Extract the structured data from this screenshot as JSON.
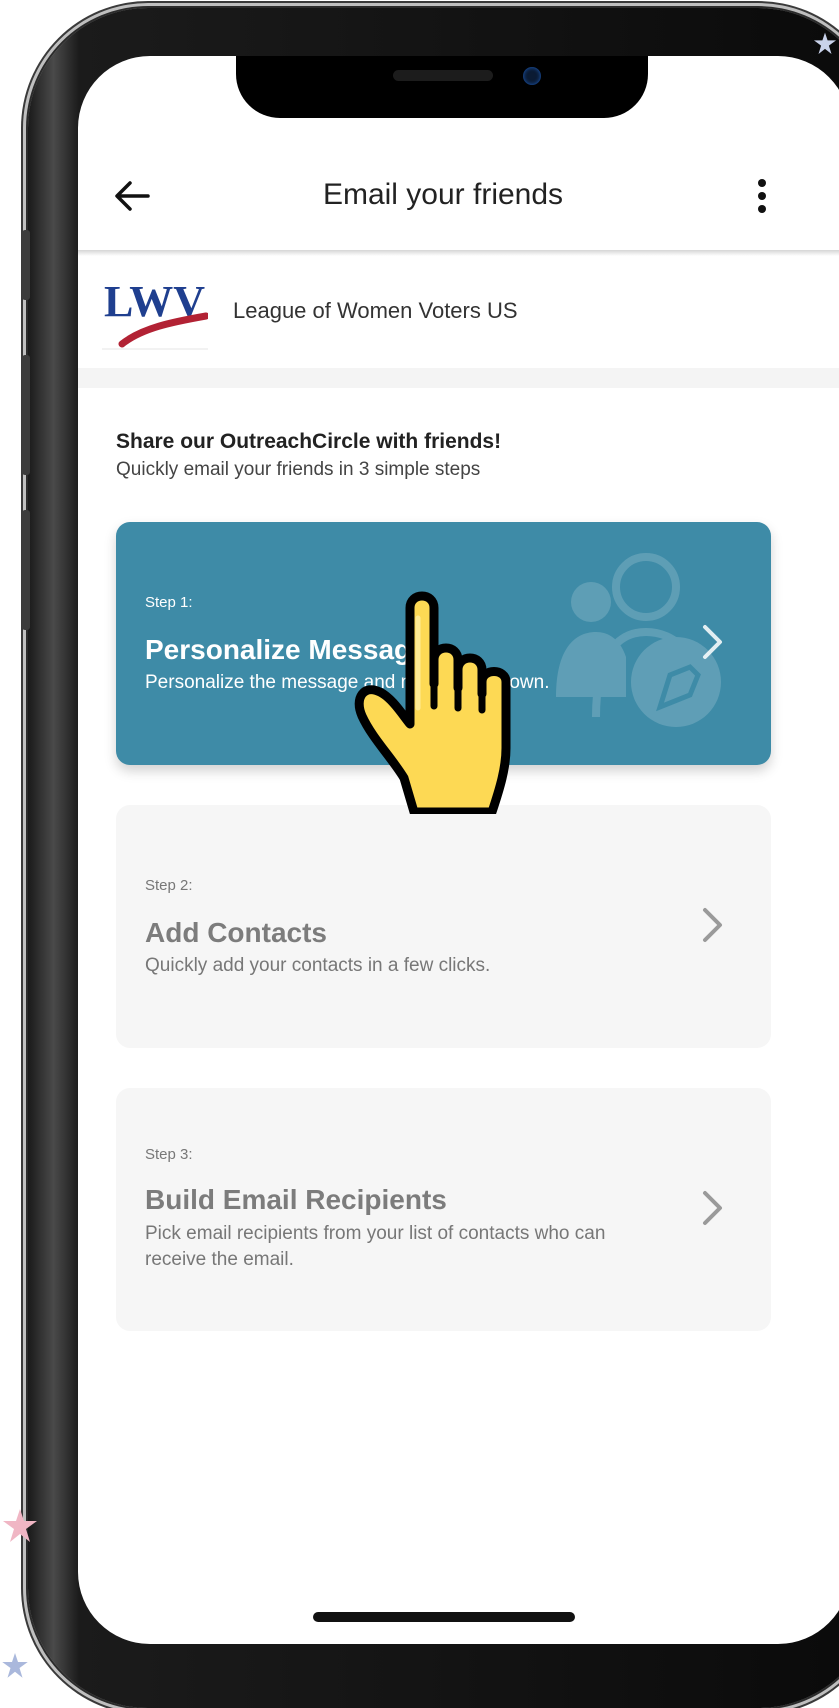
{
  "header": {
    "title": "Email your friends"
  },
  "organization": {
    "logo_text": "LWV",
    "name": "League of Women Voters US"
  },
  "intro": {
    "heading": "Share our OutreachCircle with friends!",
    "subheading": "Quickly email your friends in 3 simple steps"
  },
  "steps": [
    {
      "step_label": "Step 1:",
      "title": "Personalize Message",
      "description": "Personalize the message and make it your own.",
      "active": true
    },
    {
      "step_label": "Step 2:",
      "title": "Add Contacts",
      "description": "Quickly add your contacts in a few clicks.",
      "active": false
    },
    {
      "step_label": "Step 3:",
      "title": "Build Email Recipients",
      "description": "Pick email recipients from your list of contacts who can receive the email.",
      "active": false
    }
  ],
  "colors": {
    "active_card": "#3e8ba7",
    "inactive_card": "#f6f6f6",
    "logo_blue": "#1f3f8f",
    "logo_red": "#b22234"
  },
  "icons": [
    "back-arrow-icon",
    "more-vertical-icon",
    "chevron-right-icon",
    "person-pen-icon",
    "pointing-hand-icon"
  ]
}
